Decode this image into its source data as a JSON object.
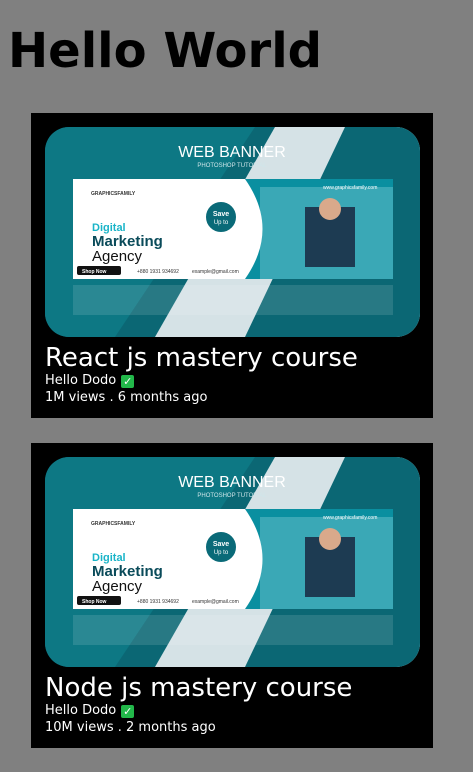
{
  "page": {
    "heading": "Hello World"
  },
  "videos": [
    {
      "title": "React js mastery course",
      "channel": "Hello Dodo",
      "views": "1M views",
      "separator": " . ",
      "age": "6 months ago",
      "verified_icon": "check-icon",
      "banner": {
        "headline": "WEB BANNER",
        "subline": "PHOTOSHOP TUTORIAL",
        "brand": "GRAPHICSFAMILY",
        "site": "www.graphicsfamily.com",
        "line1": "Digital",
        "line2": "Marketing",
        "line3": "Agency",
        "save": "Save",
        "save_sub": "Up to",
        "shop_button": "Shop Now",
        "phone": "+880 1931 934692",
        "email": "example@gmail.com"
      }
    },
    {
      "title": "Node js mastery course",
      "channel": "Hello Dodo",
      "views": "10M views",
      "separator": " . ",
      "age": "2 months ago",
      "verified_icon": "check-icon",
      "banner": {
        "headline": "WEB BANNER",
        "subline": "PHOTOSHOP TUTORIAL",
        "brand": "GRAPHICSFAMILY",
        "site": "www.graphicsfamily.com",
        "line1": "Digital",
        "line2": "Marketing",
        "line3": "Agency",
        "save": "Save",
        "save_sub": "Up to",
        "shop_button": "Shop Now",
        "phone": "+880 1931 934692",
        "email": "example@gmail.com"
      }
    }
  ],
  "colors": {
    "page_bg": "#808080",
    "card_bg": "#000000",
    "banner_teal": "#0b6774",
    "banner_dark": "#063e48",
    "accent_cyan": "#19b4c8",
    "verified_green": "#22b84a"
  }
}
